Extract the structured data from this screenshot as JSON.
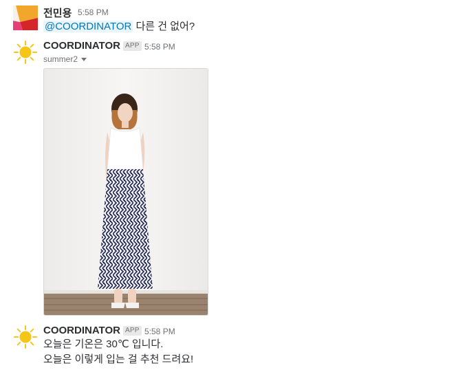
{
  "messages": [
    {
      "author": "전민용",
      "time": "5:58 PM",
      "mention": "@COORDINATOR",
      "text_after_mention": " 다른 건 없어?"
    },
    {
      "author": "COORDINATOR",
      "badge": "APP",
      "time": "5:58 PM",
      "attachment_label": "summer2",
      "icon": "sun-icon"
    },
    {
      "author": "COORDINATOR",
      "badge": "APP",
      "time": "5:58 PM",
      "line1": "오늘은 기온은 30℃ 입니다.",
      "line2": "오늘은 이렇게 입는 걸 추천 드려요!",
      "icon": "sun-icon"
    }
  ],
  "colors": {
    "mention": "#0576b9",
    "mention_bg": "#e8f5fa",
    "sun": "#f5c518"
  }
}
